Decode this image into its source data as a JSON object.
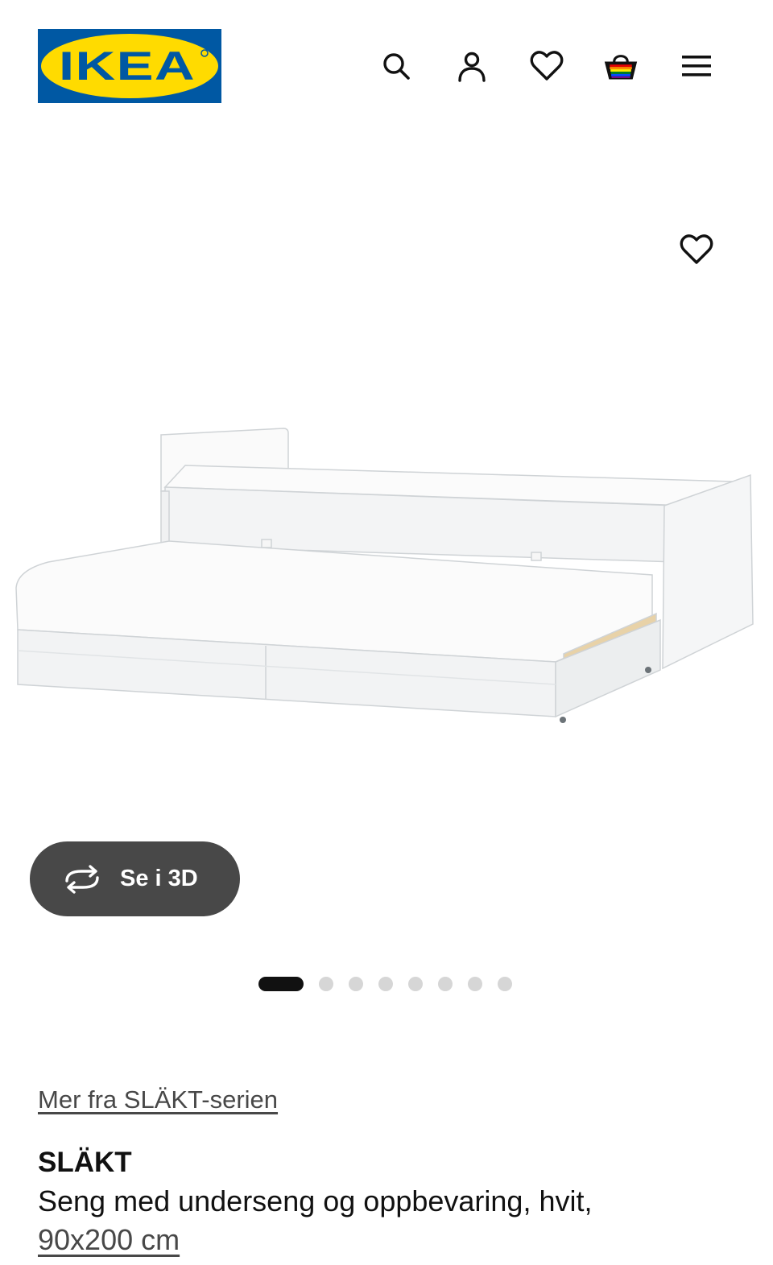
{
  "header": {
    "logo_text": "IKEA",
    "icons": [
      "search-icon",
      "user-icon",
      "heart-icon",
      "cart-icon",
      "menu-icon"
    ]
  },
  "gallery": {
    "favorite_icon": "heart-icon",
    "view_3d_label": "Se i 3D",
    "image_count": 8,
    "active_image": 1
  },
  "product": {
    "series_link": "Mer fra SLÄKT-serien",
    "name": "SLÄKT",
    "description": "Seng med underseng og oppbevaring, hvit,",
    "size": "90x200 cm"
  },
  "colors": {
    "ikea_blue": "#0058a3",
    "ikea_yellow": "#ffdb00",
    "button_dark": "#484848",
    "dot_active": "#111111",
    "dot_inactive": "#d6d6d6"
  }
}
